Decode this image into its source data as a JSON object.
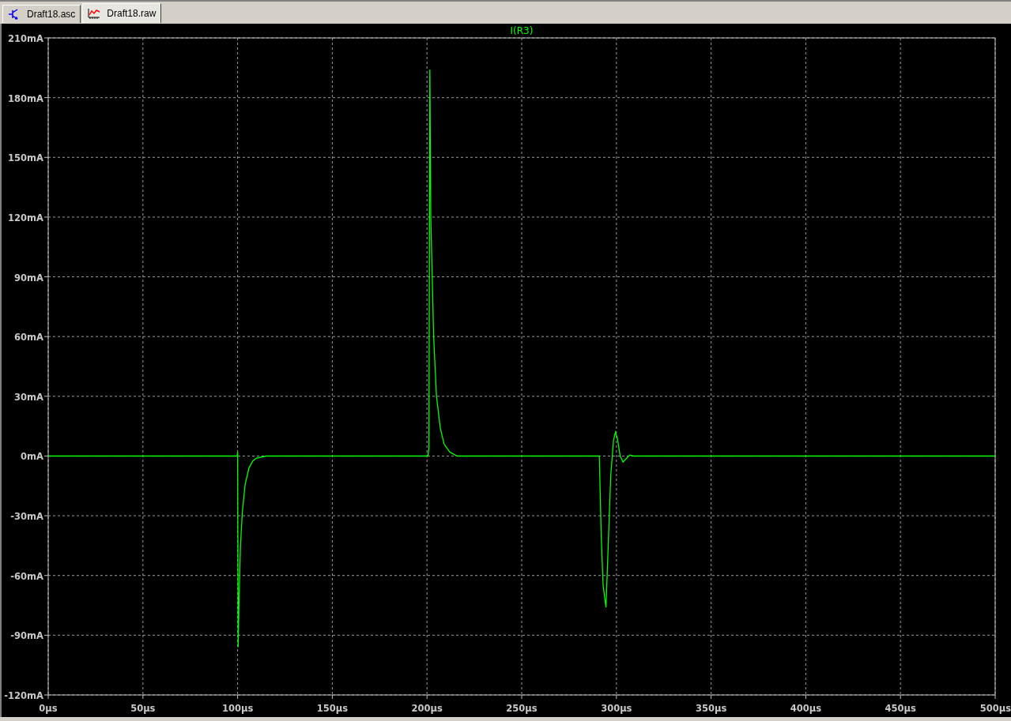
{
  "tabs": [
    {
      "label": "Draft18.asc",
      "kind": "schematic",
      "selected": false
    },
    {
      "label": "Draft18.raw",
      "kind": "waveform",
      "selected": true
    }
  ],
  "plot": {
    "chart_data": {
      "type": "line",
      "grid": true,
      "xlim": [
        0,
        500
      ],
      "ylim": [
        -120,
        210
      ],
      "xticks": [
        {
          "value": 0,
          "label": "0µs"
        },
        {
          "value": 50,
          "label": "50µs"
        },
        {
          "value": 100,
          "label": "100µs"
        },
        {
          "value": 150,
          "label": "150µs"
        },
        {
          "value": 200,
          "label": "200µs"
        },
        {
          "value": 250,
          "label": "250µs"
        },
        {
          "value": 300,
          "label": "300µs"
        },
        {
          "value": 350,
          "label": "350µs"
        },
        {
          "value": 400,
          "label": "400µs"
        },
        {
          "value": 450,
          "label": "450µs"
        },
        {
          "value": 500,
          "label": "500µs"
        }
      ],
      "yticks": [
        {
          "value": 210,
          "label": "210mA"
        },
        {
          "value": 180,
          "label": "180mA"
        },
        {
          "value": 150,
          "label": "150mA"
        },
        {
          "value": 120,
          "label": "120mA"
        },
        {
          "value": 90,
          "label": "90mA"
        },
        {
          "value": 60,
          "label": "60mA"
        },
        {
          "value": 30,
          "label": "30mA"
        },
        {
          "value": 0,
          "label": "0mA"
        },
        {
          "value": -30,
          "label": "-30mA"
        },
        {
          "value": -60,
          "label": "-60mA"
        },
        {
          "value": -90,
          "label": "-90mA"
        },
        {
          "value": -120,
          "label": "-120mA"
        }
      ],
      "x": [
        0,
        99.8,
        100,
        100.3,
        100.8,
        101.5,
        102.5,
        104,
        106,
        108,
        110,
        115,
        200.5,
        201,
        201.5,
        202,
        202.5,
        203.5,
        205,
        207,
        209,
        212,
        216,
        291,
        292,
        293,
        294.5,
        295.5,
        297,
        298.5,
        299.5,
        300.5,
        302,
        303.5,
        305,
        307,
        309,
        500
      ],
      "series": [
        {
          "name": "I(R3)",
          "color": "#00ff00",
          "values": [
            0,
            0,
            2,
            -96,
            -70,
            -45,
            -28,
            -14,
            -6,
            -2.5,
            -1,
            0,
            0,
            4,
            194,
            120,
            100,
            60,
            30,
            14,
            6,
            2,
            0,
            0,
            -40,
            -65,
            -76,
            -50,
            -10,
            8,
            12,
            9,
            0,
            -3,
            -1.5,
            0.5,
            0,
            0
          ]
        }
      ]
    }
  }
}
